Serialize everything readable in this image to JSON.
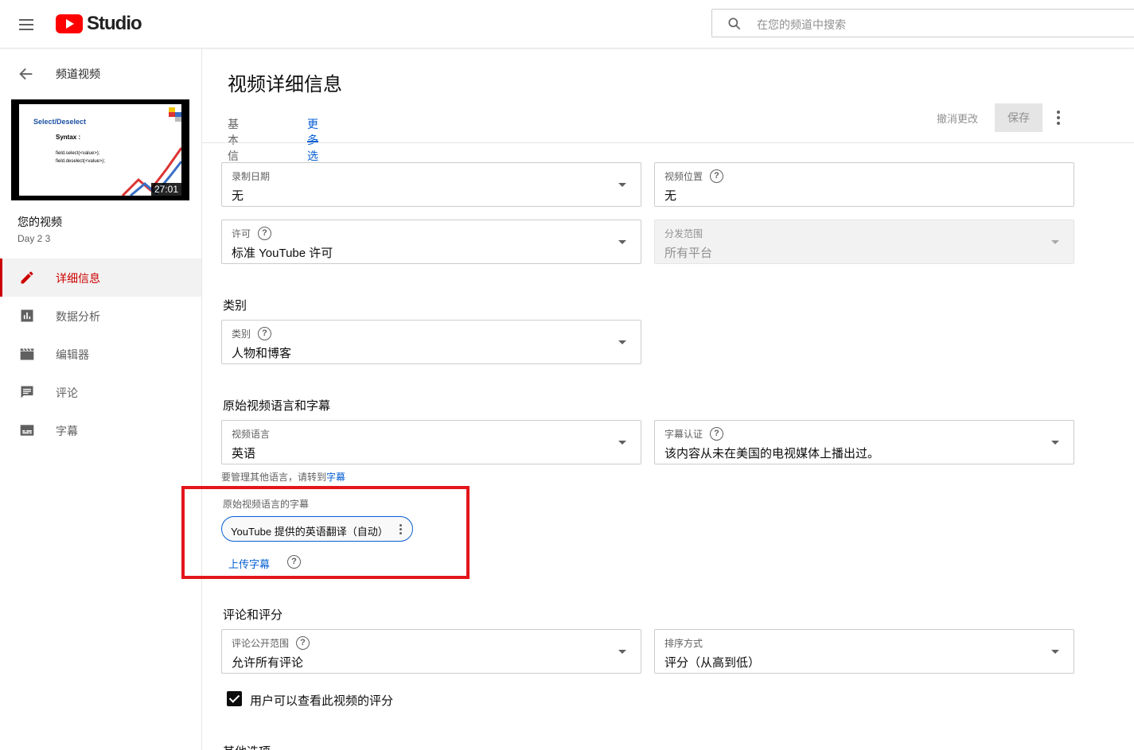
{
  "topbar": {
    "brand": "Studio",
    "search_placeholder": "在您的频道中搜索"
  },
  "sidebar": {
    "back_label": "频道视频",
    "thumbnail": {
      "title": "Select/Deselect",
      "syntax": "Syntax :",
      "code_line_1": "field.select(<value>);",
      "code_line_2": "field.deselect(<value>);",
      "duration": "27:01"
    },
    "your_video_label": "您的视频",
    "video_name": "Day 2 3",
    "items": [
      {
        "label": "详细信息",
        "icon": "pencil-icon",
        "active": true
      },
      {
        "label": "数据分析",
        "icon": "analytics-icon",
        "active": false
      },
      {
        "label": "编辑器",
        "icon": "clapperboard-icon",
        "active": false
      },
      {
        "label": "评论",
        "icon": "comment-icon",
        "active": false
      },
      {
        "label": "字幕",
        "icon": "subtitles-icon",
        "active": false
      }
    ]
  },
  "header": {
    "title": "视频详细信息",
    "tabs": [
      {
        "label": "基本信息",
        "active": false
      },
      {
        "label": "更多选项",
        "active": true
      }
    ],
    "undo_label": "撤消更改",
    "save_label": "保存"
  },
  "fields": {
    "recording_date": {
      "label": "录制日期",
      "value": "无"
    },
    "video_location": {
      "label": "视频位置",
      "value": "无"
    },
    "license": {
      "label": "许可",
      "value": "标准 YouTube 许可"
    },
    "distribution": {
      "label": "分发范围",
      "value": "所有平台"
    },
    "category_section": "类别",
    "category": {
      "label": "类别",
      "value": "人物和博客"
    },
    "language_section": "原始视频语言和字幕",
    "video_language": {
      "label": "视频语言",
      "value": "英语"
    },
    "caption_cert": {
      "label": "字幕认证",
      "value": "该内容从未在美国的电视媒体上播出过。"
    },
    "manage_text": "要管理其他语言，请转到",
    "manage_link": "字幕",
    "original_subtitles_label": "原始视频语言的字幕",
    "subtitle_chip": "YouTube 提供的英语翻译（自动）",
    "upload_subtitles": "上传字幕",
    "comments_section": "评论和评分",
    "comment_visibility": {
      "label": "评论公开范围",
      "value": "允许所有评论"
    },
    "sort_by": {
      "label": "排序方式",
      "value": "评分（从高到低）"
    },
    "show_ratings_label": "用户可以查看此视频的评分",
    "other_section": "其他选项"
  },
  "colors": {
    "accent": "#065fd4",
    "active_nav": "#cc0000",
    "highlight_box": "#e3161b"
  }
}
